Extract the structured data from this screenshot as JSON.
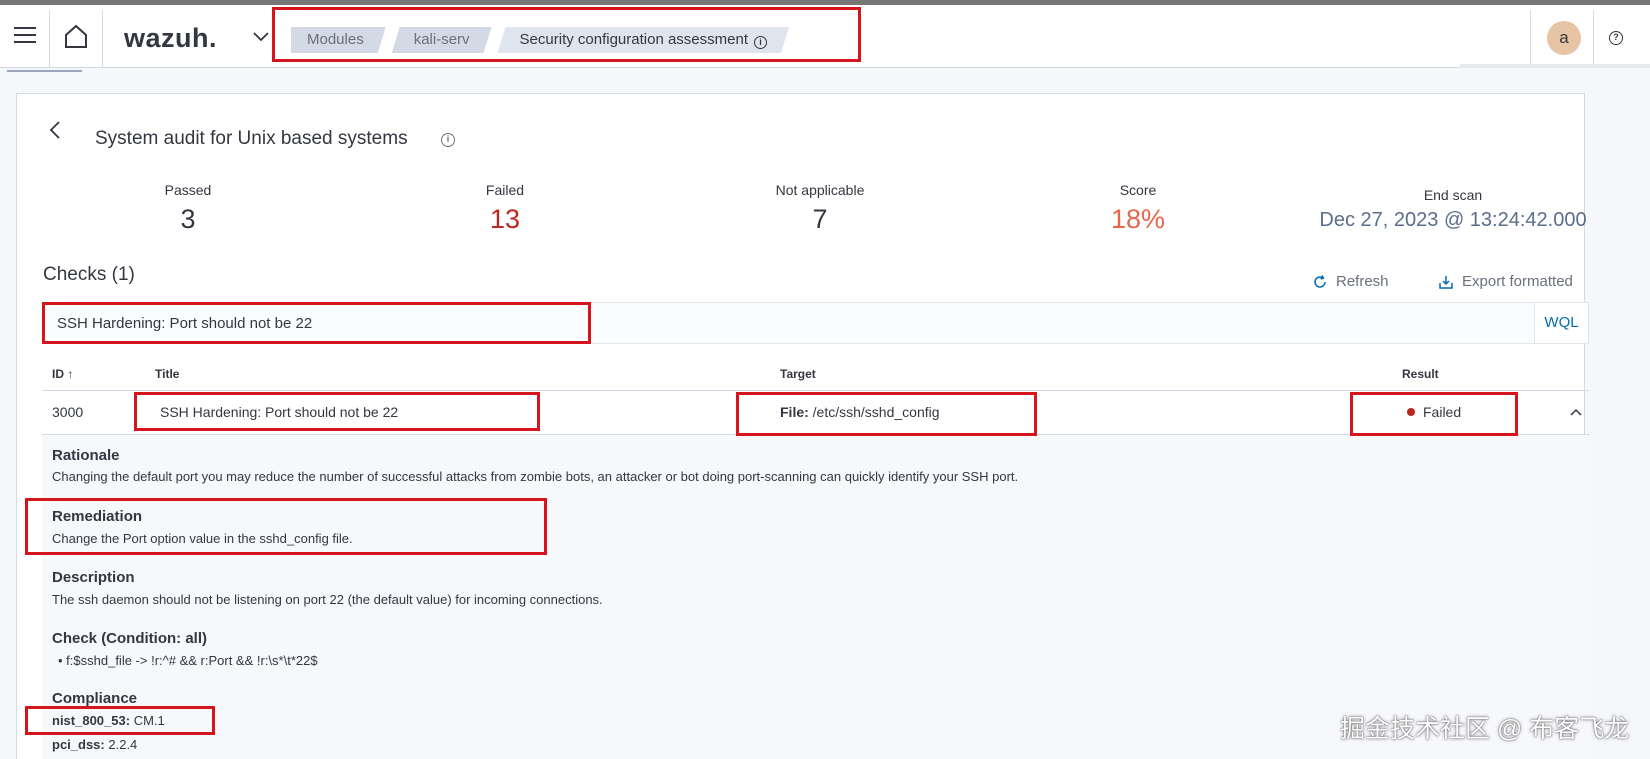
{
  "app": {
    "logo": "wazuh.",
    "avatar_initial": "a"
  },
  "breadcrumb": [
    "Modules",
    "kali-serv",
    "Security configuration assessment"
  ],
  "panel": {
    "title": "System audit for Unix based systems"
  },
  "stats": [
    {
      "label": "Passed",
      "value": "3",
      "color": "#343741"
    },
    {
      "label": "Failed",
      "value": "13",
      "color": "#bd271e"
    },
    {
      "label": "Not applicable",
      "value": "7",
      "color": "#343741"
    },
    {
      "label": "Score",
      "value": "18%",
      "color": "#e7664c"
    },
    {
      "label": "End scan",
      "value": "Dec 27, 2023 @ 13:24:42.000",
      "color": "#5a6e8c"
    }
  ],
  "checks": {
    "title": "Checks (1)",
    "refresh_label": "Refresh",
    "export_label": "Export formatted",
    "search_value": "SSH Hardening: Port should not be 22",
    "wql_label": "WQL",
    "columns": {
      "id": "ID",
      "title": "Title",
      "target": "Target",
      "result": "Result"
    },
    "rows": [
      {
        "id": "3000",
        "title": "SSH Hardening: Port should not be 22",
        "target_label": "File:",
        "target_value": "/etc/ssh/sshd_config",
        "result": "Failed"
      }
    ]
  },
  "detail": {
    "rationale_title": "Rationale",
    "rationale_text": "Changing the default port you may reduce the number of successful attacks from zombie bots, an attacker or bot doing port-scanning can quickly identify your SSH port.",
    "remediation_title": "Remediation",
    "remediation_text": "Change the Port option value in the sshd_config file.",
    "description_title": "Description",
    "description_text": "The ssh daemon should not be listening on port 22 (the default value) for incoming connections.",
    "check_title": "Check (Condition: all)",
    "check_rule": "f:$sshd_file -> !r:^# && r:Port && !r:\\s*\\t*22$",
    "compliance_title": "Compliance",
    "compliance": [
      {
        "key": "nist_800_53:",
        "value": "CM.1"
      },
      {
        "key": "pci_dss:",
        "value": "2.2.4"
      }
    ]
  },
  "watermark": "掘金技术社区 @ 布客飞龙"
}
